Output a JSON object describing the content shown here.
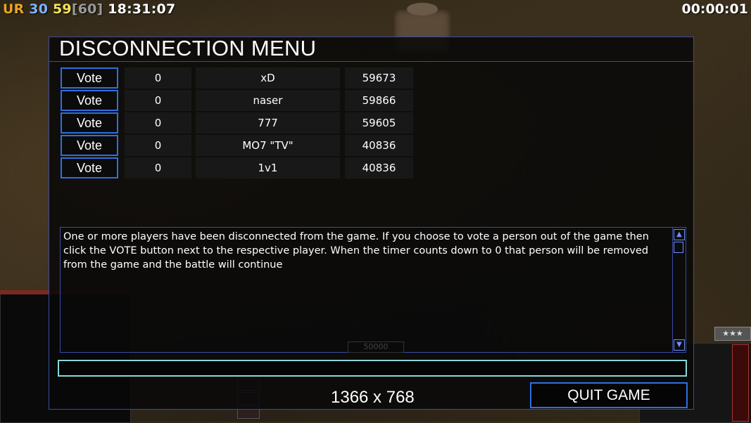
{
  "hud": {
    "faction": "UR",
    "value_a": "30",
    "value_b": "59",
    "cap": "[60]",
    "clock": "18:31:07",
    "timer": "00:00:01"
  },
  "dialog": {
    "title": "DISCONNECTION MENU",
    "players": [
      {
        "vote_label": "Vote",
        "votes": "0",
        "name": "xD",
        "id": "59673"
      },
      {
        "vote_label": "Vote",
        "votes": "0",
        "name": "naser",
        "id": "59866"
      },
      {
        "vote_label": "Vote",
        "votes": "0",
        "name": "777",
        "id": "59605"
      },
      {
        "vote_label": "Vote",
        "votes": "0",
        "name": "MO7 \"TV\"",
        "id": "40836"
      },
      {
        "vote_label": "Vote",
        "votes": "0",
        "name": "1v1",
        "id": "40836"
      }
    ],
    "message": "One or more players have been disconnected from the game. If you choose to vote a person out of the game then click the VOTE button next to the respective player. When the timer counts down to 0 that person will be removed from the game and the battle will continue",
    "chat_value": "",
    "resolution": "1366 x 768",
    "quit_label": "QUIT GAME"
  },
  "background": {
    "money_readout": "50000",
    "rank_stars": "★★★"
  },
  "colors": {
    "border_accent": "#3a4aa8",
    "button_border": "#2f6fe0",
    "chat_border": "#8bd6d8",
    "faction_color": "#e8a322",
    "value_a_color": "#7fb3ff",
    "value_b_color": "#f3e35a"
  }
}
